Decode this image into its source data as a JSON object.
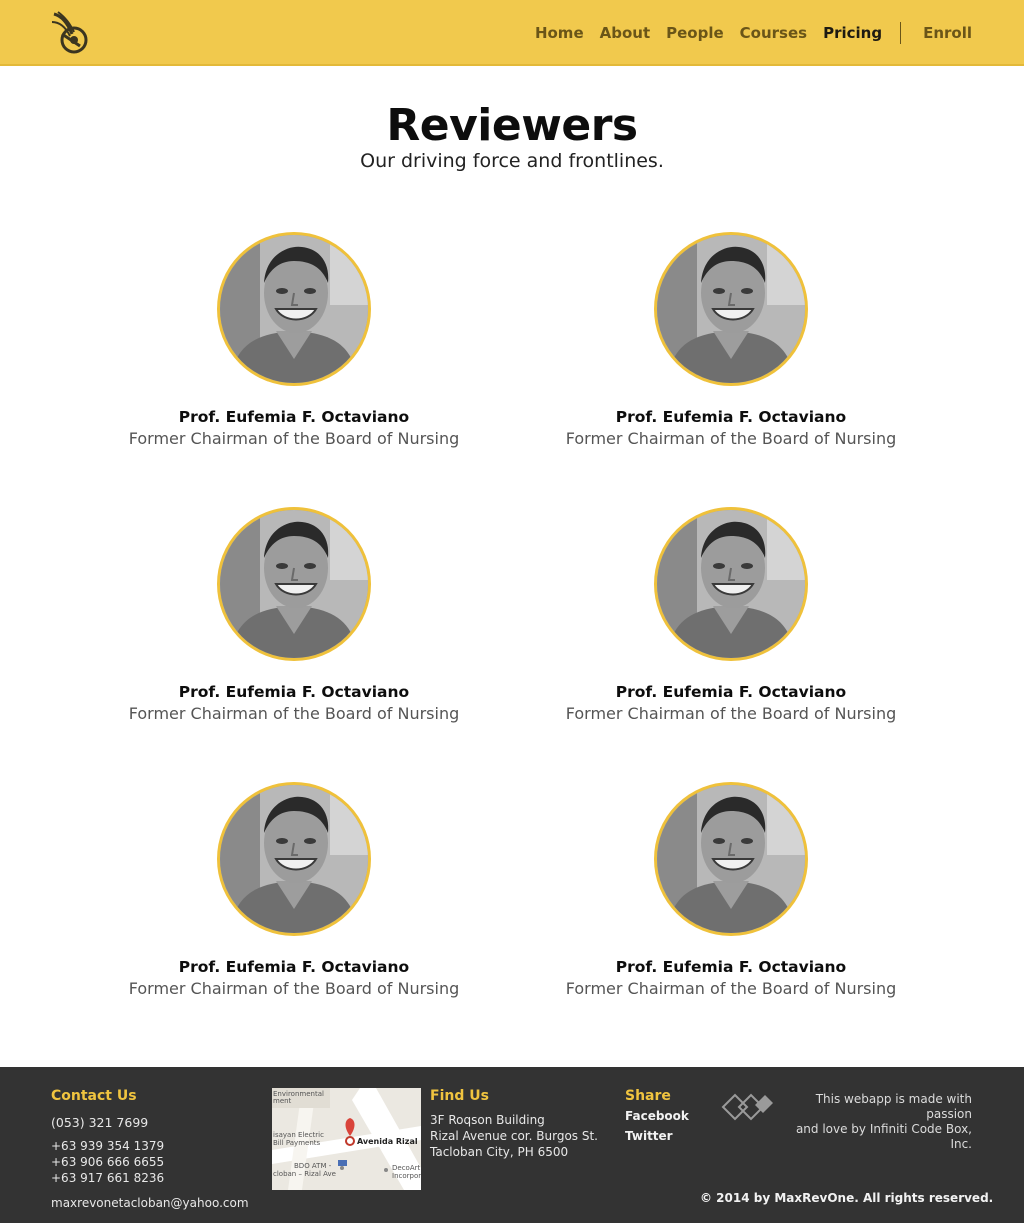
{
  "header": {
    "logo_icon": "maxrevone-logo-icon",
    "nav": [
      {
        "label": "Home"
      },
      {
        "label": "About"
      },
      {
        "label": "People"
      },
      {
        "label": "Courses"
      },
      {
        "label": "Pricing"
      }
    ],
    "enroll_label": "Enroll",
    "active_nav": "Pricing"
  },
  "hero": {
    "title": "Reviewers",
    "subtitle": "Our driving force and frontlines."
  },
  "reviewers": [
    {
      "name": "Prof. Eufemia F. Octaviano",
      "role": "Former Chairman of the Board of Nursing"
    },
    {
      "name": "Prof. Eufemia F. Octaviano",
      "role": "Former Chairman of the Board of Nursing"
    },
    {
      "name": "Prof. Eufemia F. Octaviano",
      "role": "Former Chairman of the Board of Nursing"
    },
    {
      "name": "Prof. Eufemia F. Octaviano",
      "role": "Former Chairman of the Board of Nursing"
    },
    {
      "name": "Prof. Eufemia F. Octaviano",
      "role": "Former Chairman of the Board of Nursing"
    },
    {
      "name": "Prof. Eufemia F. Octaviano",
      "role": "Former Chairman of the Board of Nursing"
    }
  ],
  "footer": {
    "contact": {
      "heading": "Contact Us",
      "phone": "(053) 321 7699",
      "mobiles": [
        "+63 939 354 1379",
        "+63 906 666 6655",
        "+63 917 661 8236"
      ],
      "email": "maxrevonetacloban@yahoo.com"
    },
    "map": {
      "labels": [
        "Environmental",
        "ment",
        "isayan Electric",
        "Bill Payments",
        "BDO ATM -",
        "cloban – Rizal Ave",
        "Avenida Rizal",
        "DecoArt",
        "Incorpor"
      ]
    },
    "find_us": {
      "heading": "Find Us",
      "address": [
        "3F Roqson Building",
        "Rizal Avenue cor. Burgos St.",
        "Tacloban City, PH 6500"
      ]
    },
    "share": {
      "heading": "Share",
      "links": [
        "Facebook",
        "Twitter"
      ]
    },
    "credit": {
      "logo_icon": "infiniti-code-box-logo-icon",
      "lines": [
        "This webapp is made with passion",
        "and love by Infiniti Code Box, Inc."
      ]
    },
    "copyright": "© 2014 by MaxRevOne. All rights reserved."
  },
  "colors": {
    "header_bg": "#f1c94d",
    "accent": "#f0c43f",
    "footer_bg": "#333333",
    "avatar_ring": "#efc13b"
  }
}
